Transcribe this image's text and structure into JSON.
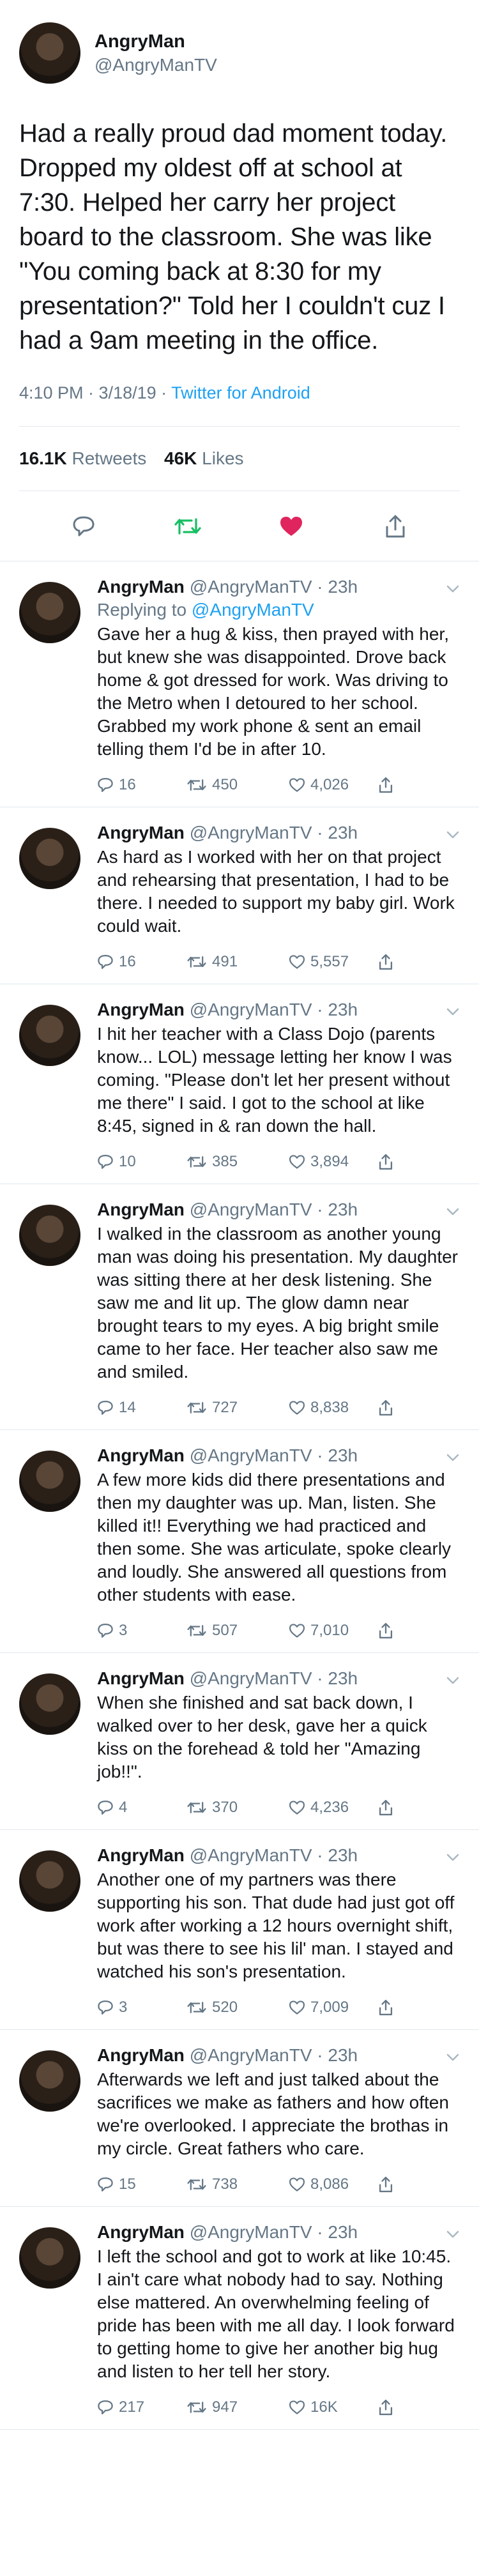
{
  "main_tweet": {
    "name": "AngryMan",
    "handle": "@AngryManTV",
    "text": "Had a really proud dad moment today. Dropped my oldest off at school at 7:30. Helped her carry her project board to the classroom. She was like \"You coming back at 8:30 for my presentation?\" Told her I couldn't cuz I had a 9am meeting in the office.",
    "time": "4:10 PM · 3/18/19 · ",
    "source": "Twitter for Android",
    "retweets_count": "16.1K",
    "retweets_label": "Retweets",
    "likes_count": "46K",
    "likes_label": "Likes"
  },
  "replies": [
    {
      "name": "AngryMan",
      "handle": "@AngryManTV · 23h",
      "replying_prefix": "Replying to ",
      "replying_to": "@AngryManTV",
      "text": "Gave her a hug & kiss, then prayed with her, but knew she was disappointed. Drove back home & got dressed for work. Was driving to the Metro when I detoured to her school. Grabbed my work phone & sent an email telling them I'd be in after 10.",
      "replies": "16",
      "retweets": "450",
      "likes": "4,026"
    },
    {
      "name": "AngryMan",
      "handle": "@AngryManTV · 23h",
      "text": "As hard as I worked with her on that project and rehearsing that presentation, I had to be there. I needed to support my baby girl. Work could wait.",
      "replies": "16",
      "retweets": "491",
      "likes": "5,557"
    },
    {
      "name": "AngryMan",
      "handle": "@AngryManTV · 23h",
      "text": "I hit her teacher with a Class Dojo (parents know... LOL) message letting her know I was coming. \"Please don't let her present without me there\" I said. I got to the school at like 8:45, signed in & ran down the hall.",
      "replies": "10",
      "retweets": "385",
      "likes": "3,894"
    },
    {
      "name": "AngryMan",
      "handle": "@AngryManTV · 23h",
      "text": "I walked in the classroom as another young man was doing his presentation. My daughter was sitting there at her desk listening. She saw me and lit up. The glow damn near brought tears to my eyes. A big bright smile came to her face. Her teacher also saw me and smiled.",
      "replies": "14",
      "retweets": "727",
      "likes": "8,838"
    },
    {
      "name": "AngryMan",
      "handle": "@AngryManTV · 23h",
      "text": "A few more kids did there presentations and then my daughter was up. Man, listen. She killed it!! Everything we had practiced and then some. She was articulate, spoke clearly and loudly. She answered all questions from other students with ease.",
      "replies": "3",
      "retweets": "507",
      "likes": "7,010"
    },
    {
      "name": "AngryMan",
      "handle": "@AngryManTV · 23h",
      "text": "When she finished and sat back down, I walked over to her desk, gave her a quick kiss on the forehead & told her \"Amazing job!!\".",
      "replies": "4",
      "retweets": "370",
      "likes": "4,236"
    },
    {
      "name": "AngryMan",
      "handle": "@AngryManTV · 23h",
      "text": "Another one of my partners was there supporting his son. That dude had just got off work after working a 12 hours overnight shift, but was there to see his lil' man. I stayed and watched his son's presentation.",
      "replies": "3",
      "retweets": "520",
      "likes": "7,009"
    },
    {
      "name": "AngryMan",
      "handle": "@AngryManTV · 23h",
      "text": "Afterwards we left and just talked about the sacrifices we make as fathers and how often we're overlooked. I appreciate the brothas in my circle. Great fathers who care.",
      "replies": "15",
      "retweets": "738",
      "likes": "8,086"
    },
    {
      "name": "AngryMan",
      "handle": "@AngryManTV · 23h",
      "text": "I left the school and got to work at like 10:45. I ain't care what nobody had to say. Nothing else mattered. An overwhelming feeling of pride has been with me all day. I look forward to getting home to give her another big hug and listen to her tell her story.",
      "replies": "217",
      "retweets": "947",
      "likes": "16K"
    }
  ],
  "colors": {
    "accent": "#1da1f2",
    "retweet_green": "#17bf63",
    "like_red": "#e0245e",
    "muted": "#657786"
  },
  "icons": {
    "reply": "reply-icon",
    "retweet": "retweet-icon",
    "like": "heart-icon",
    "share": "share-icon",
    "caret": "chevron-down-icon"
  }
}
